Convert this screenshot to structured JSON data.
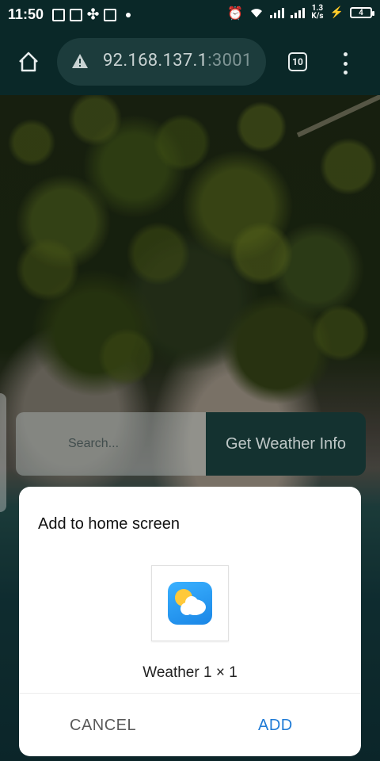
{
  "status_bar": {
    "time": "11:50",
    "net_speed_value": "1.3",
    "net_speed_unit": "K/s",
    "battery": "4"
  },
  "browser": {
    "url_host": "92.168.137.1",
    "url_port": ":3001",
    "tab_count": "10"
  },
  "page": {
    "search_placeholder": "Search...",
    "get_weather_label": "Get Weather Info"
  },
  "dialog": {
    "title": "Add to home screen",
    "app_name": "Weather  1 × 1",
    "cancel_label": "CANCEL",
    "add_label": "ADD"
  },
  "icons": [
    "home-icon",
    "warning-icon",
    "tabs-icon",
    "more-vert-icon",
    "weather-app-icon",
    "alarm-icon",
    "wifi-icon",
    "signal-icon",
    "battery-icon"
  ],
  "colors": {
    "accent": "#1f7bd6",
    "toolbar_bg": "#0a2828",
    "button_bg": "#173a37"
  }
}
